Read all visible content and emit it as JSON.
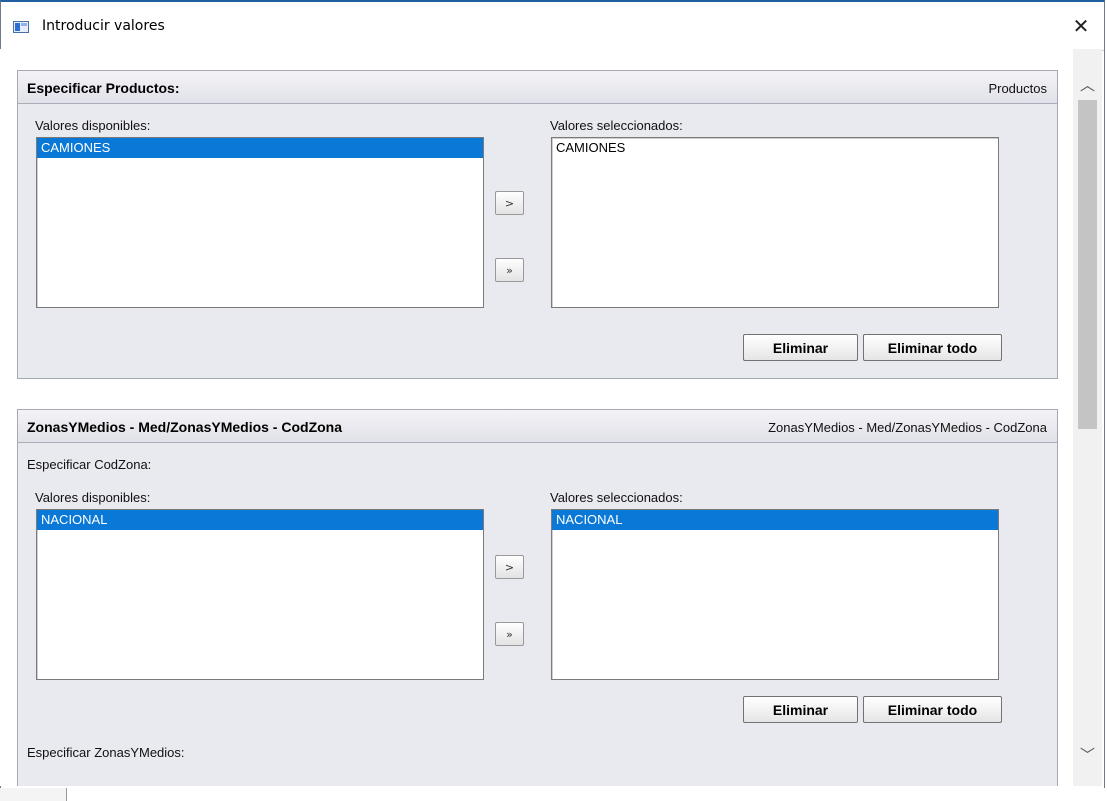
{
  "window": {
    "title": "Introducir valores",
    "close_glyph": "✕"
  },
  "scrollbar": {
    "up_glyph": "︿",
    "down_glyph": "﹀"
  },
  "panel1": {
    "title": "Especificar Productos:",
    "right_label": "Productos",
    "available_label": "Valores disponibles:",
    "available": [
      {
        "label": "CAMIONES",
        "selected": true
      }
    ],
    "selected_label": "Valores seleccionados:",
    "selected": [
      {
        "label": "CAMIONES",
        "selected": false
      }
    ],
    "add_glyph": ">",
    "add_all_glyph": "»",
    "remove_label": "Eliminar",
    "remove_all_label": "Eliminar todo"
  },
  "panel2": {
    "title": "ZonasYMedios - Med/ZonasYMedios - CodZona",
    "right_label": "ZonasYMedios - Med/ZonasYMedios - CodZona",
    "subtitle": "Especificar CodZona:",
    "available_label": "Valores disponibles:",
    "available": [
      {
        "label": "NACIONAL",
        "selected": true
      }
    ],
    "selected_label": "Valores seleccionados:",
    "selected": [
      {
        "label": "NACIONAL",
        "selected": true
      }
    ],
    "add_glyph": ">",
    "add_all_glyph": "»",
    "remove_label": "Eliminar",
    "remove_all_label": "Eliminar todo",
    "next_section_label": "Especificar ZonasYMedios:"
  },
  "colors": {
    "selection": "#0a78d7",
    "panel_bg": "#e9e9f0"
  }
}
